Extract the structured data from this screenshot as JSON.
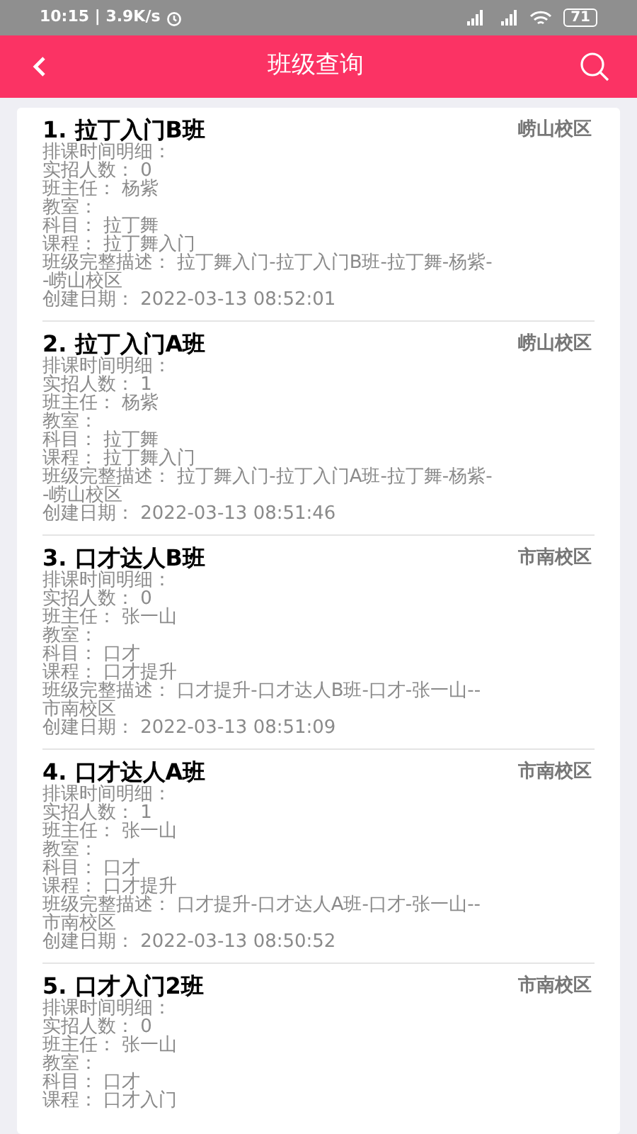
{
  "status_bar": {
    "time": "10:15 | 3.9K/s",
    "battery": "71"
  },
  "header": {
    "title": "班级查询"
  },
  "classes": [
    {
      "title": "1. 拉丁入门B班",
      "campus": "崂山校区",
      "fields": [
        {
          "label": "排课时间明细："
        },
        {
          "label": "实招人数：",
          "value": "0"
        },
        {
          "label": "班主任：",
          "value": "杨紫"
        },
        {
          "label": "教室："
        },
        {
          "label": "科目：",
          "value": "拉丁舞"
        },
        {
          "label": "课程：",
          "value": "拉丁舞入门"
        },
        {
          "label": "班级完整描述：",
          "value": "拉丁舞入门-拉丁入门B班-拉丁舞-杨紫--崂山校区"
        },
        {
          "label": "创建日期：",
          "value": "2022-03-13 08:52:01"
        }
      ]
    },
    {
      "title": "2. 拉丁入门A班",
      "campus": "崂山校区",
      "fields": [
        {
          "label": "排课时间明细："
        },
        {
          "label": "实招人数：",
          "value": "1"
        },
        {
          "label": "班主任：",
          "value": "杨紫"
        },
        {
          "label": "教室："
        },
        {
          "label": "科目：",
          "value": "拉丁舞"
        },
        {
          "label": "课程：",
          "value": "拉丁舞入门"
        },
        {
          "label": "班级完整描述：",
          "value": "拉丁舞入门-拉丁入门A班-拉丁舞-杨紫--崂山校区"
        },
        {
          "label": "创建日期：",
          "value": "2022-03-13 08:51:46"
        }
      ]
    },
    {
      "title": "3. 口才达人B班",
      "campus": "市南校区",
      "fields": [
        {
          "label": "排课时间明细："
        },
        {
          "label": "实招人数：",
          "value": "0"
        },
        {
          "label": "班主任：",
          "value": "张一山"
        },
        {
          "label": "教室："
        },
        {
          "label": "科目：",
          "value": "口才"
        },
        {
          "label": "课程：",
          "value": "口才提升"
        },
        {
          "label": "班级完整描述：",
          "value": "口才提升-口才达人B班-口才-张一山--市南校区"
        },
        {
          "label": "创建日期：",
          "value": "2022-03-13 08:51:09"
        }
      ]
    },
    {
      "title": "4. 口才达人A班",
      "campus": "市南校区",
      "fields": [
        {
          "label": "排课时间明细："
        },
        {
          "label": "实招人数：",
          "value": "1"
        },
        {
          "label": "班主任：",
          "value": "张一山"
        },
        {
          "label": "教室："
        },
        {
          "label": "科目：",
          "value": "口才"
        },
        {
          "label": "课程：",
          "value": "口才提升"
        },
        {
          "label": "班级完整描述：",
          "value": "口才提升-口才达人A班-口才-张一山--市南校区"
        },
        {
          "label": "创建日期：",
          "value": "2022-03-13 08:50:52"
        }
      ]
    },
    {
      "title": "5. 口才入门2班",
      "campus": "市南校区",
      "fields": [
        {
          "label": "排课时间明细："
        },
        {
          "label": "实招人数：",
          "value": "0"
        },
        {
          "label": "班主任：",
          "value": "张一山"
        },
        {
          "label": "教室："
        },
        {
          "label": "科目：",
          "value": "口才"
        },
        {
          "label": "课程：",
          "value": "口才入门"
        }
      ]
    }
  ]
}
